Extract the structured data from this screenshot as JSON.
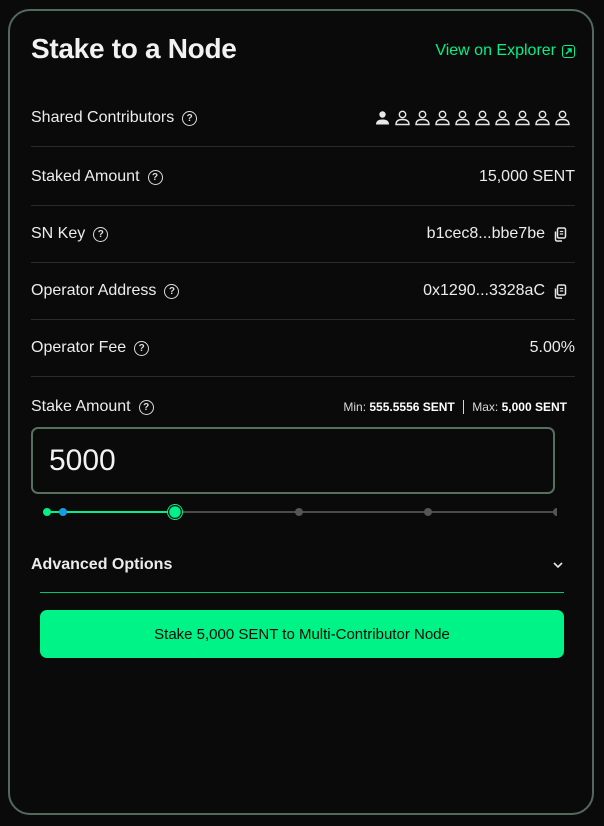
{
  "header": {
    "title": "Stake to a Node",
    "explorer_link": "View on Explorer"
  },
  "details": {
    "shared_contributors": {
      "label": "Shared Contributors",
      "filled_slots": 1,
      "total_slots": 10
    },
    "staked_amount": {
      "label": "Staked Amount",
      "value": "15,000 SENT"
    },
    "sn_key": {
      "label": "SN Key",
      "value": "b1cec8...bbe7be"
    },
    "operator_address": {
      "label": "Operator Address",
      "value": "0x1290...3328aC"
    },
    "operator_fee": {
      "label": "Operator Fee",
      "value": "5.00%"
    }
  },
  "stake": {
    "label": "Stake Amount",
    "min_label": "Min:",
    "min_value": "555.5556 SENT",
    "max_label": "Max:",
    "max_value": "5,000 SENT",
    "input_value": "5000"
  },
  "slider": {
    "stops": 5,
    "active_stop": 1
  },
  "advanced": {
    "label": "Advanced Options"
  },
  "action": {
    "button_label": "Stake 5,000 SENT to Multi-Contributor Node"
  },
  "colors": {
    "accent": "#00f386",
    "border": "#52695c",
    "background": "#0a0a0a"
  },
  "icons": [
    "external-link-icon",
    "help-icon",
    "person-icon",
    "copy-icon",
    "chevron-down-icon"
  ]
}
